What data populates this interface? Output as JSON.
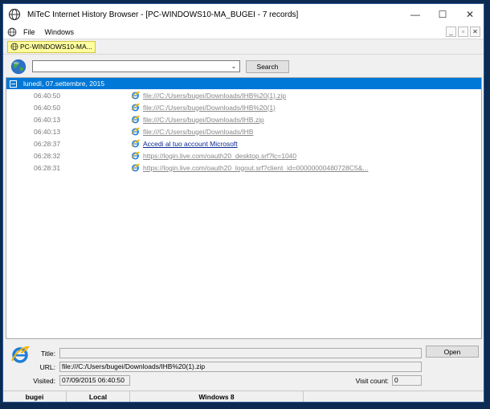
{
  "window": {
    "title": "MiTeC Internet History Browser - [PC-WINDOWS10-MA_BUGEI - 7 records]",
    "minimize": "—",
    "maximize": "☐",
    "close": "✕"
  },
  "menu": {
    "items": [
      "File",
      "Windows"
    ],
    "mdi": [
      "_",
      "▫",
      "✕"
    ]
  },
  "tab": {
    "label": "PC-WINDOWS10-MA..."
  },
  "toolbar": {
    "search_label": "Search",
    "combo_value": ""
  },
  "list": {
    "group": "lunedì, 07.settembre, 2015",
    "rows": [
      {
        "time": "06:40:50",
        "url": "file:///C:/Users/bugei/Downloads/IHB%20(1).zip",
        "highlight": false
      },
      {
        "time": "06:40:50",
        "url": "file:///C:/Users/bugei/Downloads/IHB%20(1)",
        "highlight": false
      },
      {
        "time": "06:40:13",
        "url": "file:///C:/Users/bugei/Downloads/IHB.zip",
        "highlight": false
      },
      {
        "time": "06:40:13",
        "url": "file:///C:/Users/bugei/Downloads/IHB",
        "highlight": false
      },
      {
        "time": "06:28:37",
        "url": "Accedi al tuo account Microsoft",
        "highlight": true
      },
      {
        "time": "06:28:32",
        "url": "https://login.live.com/oauth20_desktop.srf?lc=1040",
        "highlight": false
      },
      {
        "time": "06:28:31",
        "url": "https://login.live.com/oauth20_logout.srf?client_id=00000000480728C5&...",
        "highlight": false
      }
    ]
  },
  "details": {
    "title_label": "Title:",
    "title_value": "",
    "url_label": "URL:",
    "url_value": "file:///C:/Users/bugei/Downloads/IHB%20(1).zip",
    "visited_label": "Visited:",
    "visited_value": "07/09/2015 06:40:50",
    "visit_count_label": "Visit count:",
    "visit_count_value": "0",
    "open_label": "Open"
  },
  "status": {
    "user": "bugei",
    "location": "Local",
    "os": "Windows 8"
  }
}
